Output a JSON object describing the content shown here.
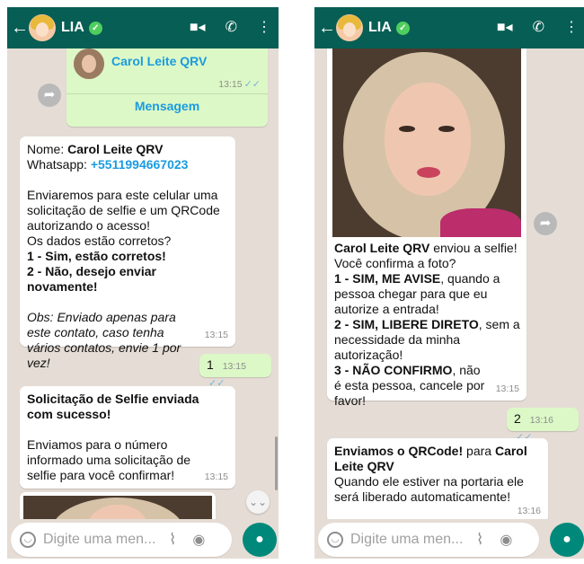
{
  "header": {
    "contact_name": "LIA",
    "back_icon": "arrow-left-icon",
    "verified_icon": "verified-check-icon",
    "video_icon": "video-call-icon",
    "phone_icon": "phone-call-icon",
    "menu_icon": "more-vertical-icon"
  },
  "left": {
    "contact_card": {
      "name": "Carol Leite QRV",
      "time": "13:15",
      "action": "Mensagem"
    },
    "msg_info": {
      "name_label": "Nome:",
      "name_value": "Carol Leite QRV",
      "whatsapp_label": "Whatsapp:",
      "whatsapp_value": "+5511994667023",
      "p1": "Enviaremos para este celular uma solicitação de selfie e um QRCode autorizando o acesso!",
      "p2": "Os dados estão corretos?",
      "opt1": "1 - Sim, estão corretos!",
      "opt2": "2 - Não, desejo enviar novamente!",
      "obs": "Obs: Enviado apenas para este contato, caso tenha vários contatos, envie 1 por vez!",
      "time": "13:15"
    },
    "reply_1": {
      "text": "1",
      "time": "13:15"
    },
    "msg_selfie_sent": {
      "title": "Solicitação de Selfie enviada com sucesso!",
      "body": "Enviamos para o número informado uma solicitação de selfie para você confirmar!",
      "time": "13:15"
    }
  },
  "right": {
    "msg_selfie_confirm": {
      "name": "Carol Leite QRV",
      "sent_text": " enviou a selfie!",
      "question": "Você confirma a foto?",
      "opt1_bold": "1 - SIM, ME AVISE",
      "opt1_rest": ", quando a pessoa chegar para que eu autorize a entrada!",
      "opt2_bold": "2 - SIM, LIBERE DIRETO",
      "opt2_rest": ", sem a necessidade da minha autorização!",
      "opt3_bold": "3 - NÃO CONFIRMO",
      "opt3_rest": ", não é esta pessoa, cancele por favor!",
      "time": "13:15"
    },
    "reply_2": {
      "text": "2",
      "time": "13:16"
    },
    "msg_qrcode": {
      "title_bold": "Enviamos o QRCode!",
      "title_mid": " para ",
      "title_name": "Carol Leite QRV",
      "body": "Quando ele estiver na portaria ele será liberado automaticamente!",
      "time": "13:16"
    }
  },
  "input": {
    "placeholder": "Digite uma men..."
  },
  "ticks": "✓✓"
}
